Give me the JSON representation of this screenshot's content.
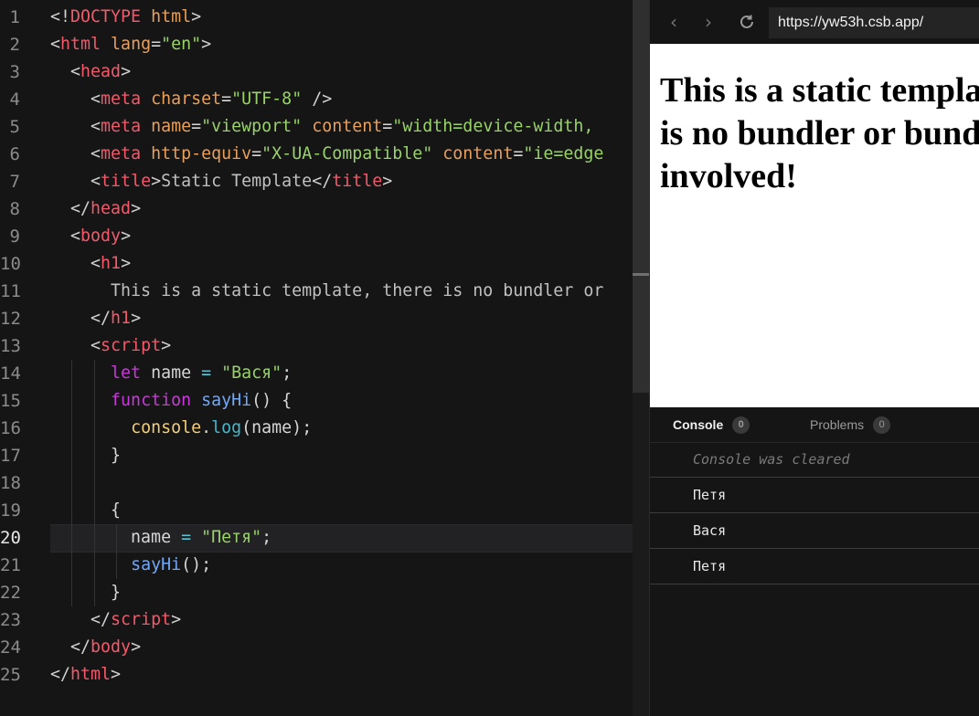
{
  "editor": {
    "active_line": 20,
    "lines": [
      {
        "n": "1",
        "code": [
          [
            "t-br",
            "<!"
          ],
          [
            "t-tag",
            "DOCTYPE"
          ],
          [
            "t-attr",
            " html"
          ],
          [
            "t-br",
            ">"
          ]
        ]
      },
      {
        "n": "2",
        "code": [
          [
            "t-br",
            "<"
          ],
          [
            "t-tag",
            "html"
          ],
          [
            "t-attr",
            " lang"
          ],
          [
            "t-pl",
            "="
          ],
          [
            "t-str",
            "\"en\""
          ],
          [
            "t-br",
            ">"
          ]
        ]
      },
      {
        "n": "3",
        "code": [
          [
            "t-pl",
            "  "
          ],
          [
            "t-br",
            "<"
          ],
          [
            "t-tag",
            "head"
          ],
          [
            "t-br",
            ">"
          ]
        ]
      },
      {
        "n": "4",
        "code": [
          [
            "t-pl",
            "    "
          ],
          [
            "t-br",
            "<"
          ],
          [
            "t-tag",
            "meta"
          ],
          [
            "t-attr",
            " charset"
          ],
          [
            "t-pl",
            "="
          ],
          [
            "t-str",
            "\"UTF-8\""
          ],
          [
            "t-br",
            " />"
          ]
        ]
      },
      {
        "n": "5",
        "code": [
          [
            "t-pl",
            "    "
          ],
          [
            "t-br",
            "<"
          ],
          [
            "t-tag",
            "meta"
          ],
          [
            "t-attr",
            " name"
          ],
          [
            "t-pl",
            "="
          ],
          [
            "t-str",
            "\"viewport\""
          ],
          [
            "t-attr",
            " content"
          ],
          [
            "t-pl",
            "="
          ],
          [
            "t-str",
            "\"width=device-width,"
          ]
        ]
      },
      {
        "n": "6",
        "code": [
          [
            "t-pl",
            "    "
          ],
          [
            "t-br",
            "<"
          ],
          [
            "t-tag",
            "meta"
          ],
          [
            "t-attr",
            " http-equiv"
          ],
          [
            "t-pl",
            "="
          ],
          [
            "t-str",
            "\"X-UA-Compatible\""
          ],
          [
            "t-attr",
            " content"
          ],
          [
            "t-pl",
            "="
          ],
          [
            "t-str",
            "\"ie=edge"
          ]
        ]
      },
      {
        "n": "7",
        "code": [
          [
            "t-pl",
            "    "
          ],
          [
            "t-br",
            "<"
          ],
          [
            "t-tag",
            "title"
          ],
          [
            "t-br",
            ">"
          ],
          [
            "t-txt",
            "Static Template"
          ],
          [
            "t-br",
            "</"
          ],
          [
            "t-tag",
            "title"
          ],
          [
            "t-br",
            ">"
          ]
        ]
      },
      {
        "n": "8",
        "code": [
          [
            "t-pl",
            "  "
          ],
          [
            "t-br",
            "</"
          ],
          [
            "t-tag",
            "head"
          ],
          [
            "t-br",
            ">"
          ]
        ]
      },
      {
        "n": "9",
        "code": [
          [
            "t-pl",
            "  "
          ],
          [
            "t-br",
            "<"
          ],
          [
            "t-tag",
            "body"
          ],
          [
            "t-br",
            ">"
          ]
        ]
      },
      {
        "n": "10",
        "code": [
          [
            "t-pl",
            "    "
          ],
          [
            "t-br",
            "<"
          ],
          [
            "t-tag",
            "h1"
          ],
          [
            "t-br",
            ">"
          ]
        ]
      },
      {
        "n": "11",
        "code": [
          [
            "t-txt",
            "      This is a static template, there is no bundler or"
          ]
        ]
      },
      {
        "n": "12",
        "code": [
          [
            "t-pl",
            "    "
          ],
          [
            "t-br",
            "</"
          ],
          [
            "t-tag",
            "h1"
          ],
          [
            "t-br",
            ">"
          ]
        ]
      },
      {
        "n": "13",
        "code": [
          [
            "t-pl",
            "    "
          ],
          [
            "t-br",
            "<"
          ],
          [
            "t-tag",
            "script"
          ],
          [
            "t-br",
            ">"
          ]
        ]
      },
      {
        "n": "14",
        "code": [
          [
            "t-pl",
            "      "
          ],
          [
            "t-kw",
            "let"
          ],
          [
            "t-pl",
            " name "
          ],
          [
            "t-op",
            "="
          ],
          [
            "t-str",
            " \"Вася\""
          ],
          [
            "t-pl",
            ";"
          ]
        ]
      },
      {
        "n": "15",
        "code": [
          [
            "t-pl",
            "      "
          ],
          [
            "t-kw",
            "function"
          ],
          [
            "t-fn",
            " sayHi"
          ],
          [
            "t-pl",
            "() {"
          ]
        ]
      },
      {
        "n": "16",
        "code": [
          [
            "t-pl",
            "        "
          ],
          [
            "t-obj",
            "console"
          ],
          [
            "t-pl",
            "."
          ],
          [
            "t-meth",
            "log"
          ],
          [
            "t-pl",
            "(name);"
          ]
        ]
      },
      {
        "n": "17",
        "code": [
          [
            "t-pl",
            "      }"
          ]
        ]
      },
      {
        "n": "18",
        "code": []
      },
      {
        "n": "19",
        "code": [
          [
            "t-pl",
            "      {"
          ]
        ]
      },
      {
        "n": "20",
        "code": [
          [
            "t-pl",
            "        name "
          ],
          [
            "t-op",
            "="
          ],
          [
            "t-str",
            " \"Петя\""
          ],
          [
            "t-pl",
            ";"
          ]
        ]
      },
      {
        "n": "21",
        "code": [
          [
            "t-pl",
            "        "
          ],
          [
            "t-fn",
            "sayHi"
          ],
          [
            "t-pl",
            "();"
          ]
        ]
      },
      {
        "n": "22",
        "code": [
          [
            "t-pl",
            "      }"
          ]
        ]
      },
      {
        "n": "23",
        "code": [
          [
            "t-pl",
            "    "
          ],
          [
            "t-br",
            "</"
          ],
          [
            "t-tag",
            "script"
          ],
          [
            "t-br",
            ">"
          ]
        ]
      },
      {
        "n": "24",
        "code": [
          [
            "t-pl",
            "  "
          ],
          [
            "t-br",
            "</"
          ],
          [
            "t-tag",
            "body"
          ],
          [
            "t-br",
            ">"
          ]
        ]
      },
      {
        "n": "25",
        "code": [
          [
            "t-br",
            "</"
          ],
          [
            "t-tag",
            "html"
          ],
          [
            "t-br",
            ">"
          ]
        ]
      }
    ]
  },
  "browser": {
    "back_icon": "chevron-left-icon",
    "forward_icon": "chevron-right-icon",
    "reload_icon": "reload-icon",
    "url": "https://yw53h.csb.app/"
  },
  "preview": {
    "heading": "This is a static template, there is no bundler or bundling involved!"
  },
  "console": {
    "tabs": [
      {
        "label": "Console",
        "badge": "0"
      },
      {
        "label": "Problems",
        "badge": "0"
      }
    ],
    "cleared_message": "Console was cleared",
    "logs": [
      "Петя",
      "Вася",
      "Петя"
    ]
  }
}
